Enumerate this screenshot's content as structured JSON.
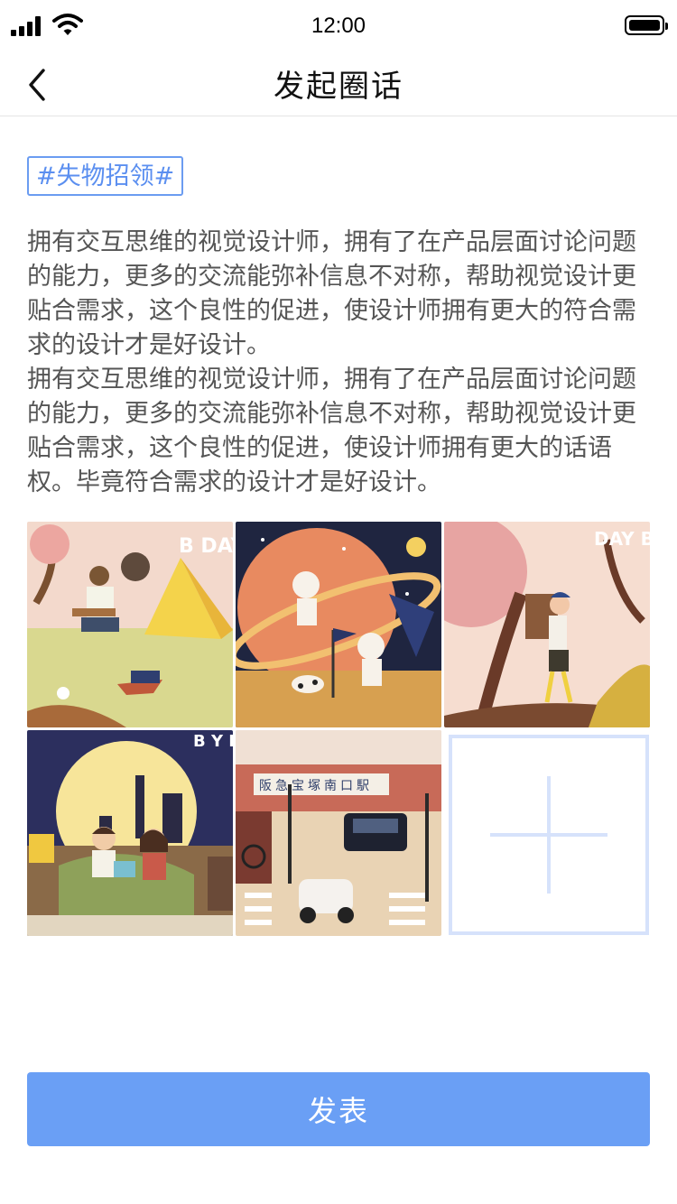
{
  "status_bar": {
    "time": "12:00"
  },
  "nav": {
    "title": "发起圈话"
  },
  "topic_tag": "#失物招领#",
  "content": {
    "paragraphs": [
      "拥有交互思维的视觉设计师，拥有了在产品层面讨论问题的能力，更多的交流能弥补信息不对称，帮助视觉设计更贴合需求，这个良性的促进，使设计师拥有更大的符合需求的设计才是好设计。",
      "拥有交互思维的视觉设计师，拥有了在产品层面讨论问题的能力，更多的交流能弥补信息不对称，帮助视觉设计更贴合需求，这个良性的促进，使设计师拥有更大的话语权。毕竟符合需求的设计才是好设计。"
    ]
  },
  "images": {
    "img1_text": "B DAY",
    "img3_text": "DAY B DAY",
    "img4_text": "B Y DAY",
    "img5_sign": "阪急宝塚南口駅"
  },
  "colors": {
    "accent": "#6a9ff5",
    "tag": "#5b8ff0",
    "add_border": "#d6e2fb"
  },
  "submit": {
    "label": "发表"
  }
}
